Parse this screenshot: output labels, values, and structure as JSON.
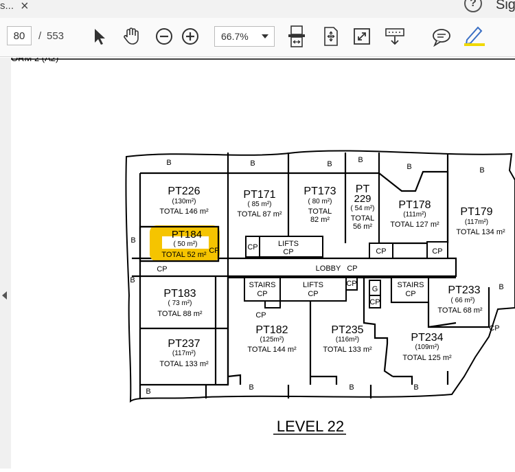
{
  "window": {
    "tab_fragment": "s...",
    "sign_fragment": "Sig"
  },
  "toolbar": {
    "page_current": "80",
    "page_sep": "/",
    "page_total": "553",
    "zoom": "66.7%",
    "icons": [
      "select-arrow-icon",
      "hand-tool-icon",
      "zoom-out-icon",
      "zoom-in-icon",
      "zoom-dropdown-icon",
      "fit-page-icon",
      "scroll-mode-icon",
      "fullscreen-icon",
      "read-mode-icon",
      "comment-icon",
      "highlight-icon"
    ],
    "highlight_color": "#f0d800"
  },
  "page": {
    "header_fragment": "ORM 2 (A2)",
    "level_title": "LEVEL 22",
    "highlight_color": "#f5c400",
    "units": [
      {
        "id": "PT226",
        "area": "(130m²)",
        "total": "TOTAL 146 m²"
      },
      {
        "id": "PT171",
        "area": "( 85 m²)",
        "total": "TOTAL  87 m²"
      },
      {
        "id": "PT173",
        "area": "( 80 m²)",
        "total1": "TOTAL",
        "total2": "82 m²"
      },
      {
        "id1": "PT",
        "id2": "229",
        "area": "( 54 m²)",
        "total1": "TOTAL",
        "total2": "56 m²"
      },
      {
        "id": "PT178",
        "area": "(111m²)",
        "total": "TOTAL 127 m²"
      },
      {
        "id": "PT179",
        "area": "(117m²)",
        "total": "TOTAL 134 m²"
      },
      {
        "id": "PT184",
        "area": "( 50 m²)",
        "total": "TOTAL  52  m²"
      },
      {
        "id": "PT183",
        "area": "( 73 m²)",
        "total": "TOTAL  88  m²"
      },
      {
        "id": "PT237",
        "area": "(117m²)",
        "total": "TOTAL 133 m²"
      },
      {
        "id": "PT182",
        "area": "(125m²)",
        "total": "TOTAL 144 m²"
      },
      {
        "id": "PT235",
        "area": "(116m²)",
        "total": "TOTAL 133 m²"
      },
      {
        "id": "PT234",
        "area": "(109m²)",
        "total": "TOTAL 125 m²"
      },
      {
        "id": "PT233",
        "area": "( 66 m²)",
        "total": "TOTAL  68  m²"
      }
    ],
    "labels": {
      "b": "B",
      "cp": "CP",
      "g": "G",
      "lifts": "LIFTS",
      "stairs": "STAIRS",
      "lobby": "LOBBY",
      "lobby_cp": "CP"
    }
  }
}
